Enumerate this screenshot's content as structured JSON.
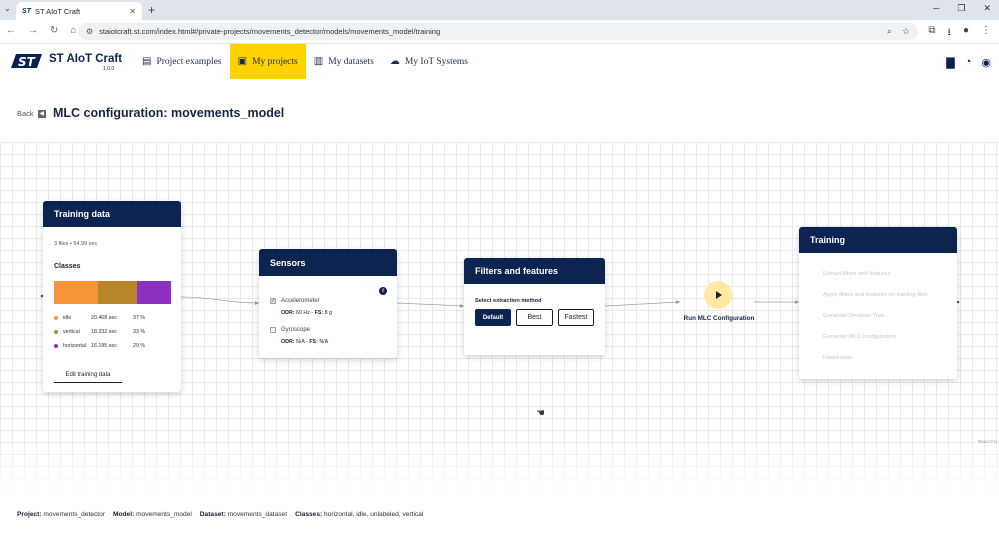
{
  "browser": {
    "tab_title": "ST AIoT Craft",
    "tab_favicon": "ST",
    "url": "staiotcraft.st.com/index.html#/private-projects/movements_detector/models/movements_model/training"
  },
  "app": {
    "brand": "ST AIoT Craft",
    "version": "1.0.0",
    "nav": [
      {
        "label": "Project examples",
        "icon": "folder-list-icon"
      },
      {
        "label": "My projects",
        "icon": "user-folder-icon",
        "active": true
      },
      {
        "label": "My datasets",
        "icon": "dataset-icon"
      },
      {
        "label": "My IoT Systems",
        "icon": "cloud-icon"
      }
    ],
    "accent_color": "#ffd200",
    "header_color": "#0d2350"
  },
  "page": {
    "back_label": "Back",
    "title": "MLC configuration: movements_model"
  },
  "training_data": {
    "title": "Training data",
    "meta": "3 files • 54.99 sec",
    "classes_label": "Classes",
    "classes": [
      {
        "name": "idle",
        "seconds": "20.468 sec",
        "percent": "37 %",
        "share": 37,
        "color": "#f7943a"
      },
      {
        "name": "vertical",
        "seconds": "18.332 sec",
        "percent": "33 %",
        "share": 33,
        "color": "#b8862a"
      },
      {
        "name": "horizontal",
        "seconds": "16.195 sec",
        "percent": "29 %",
        "share": 29,
        "color": "#8e2fc4"
      }
    ],
    "edit_label": "Edit training data"
  },
  "sensors": {
    "title": "Sensors",
    "items": [
      {
        "name": "Accelerometer",
        "checked": true,
        "odr_label": "ODR:",
        "odr": "60 Hz",
        "fs_label": "FS:",
        "fs": "8 g"
      },
      {
        "name": "Gyroscope",
        "checked": false,
        "odr_label": "ODR:",
        "odr": "N/A",
        "fs_label": "FS:",
        "fs": "N/A"
      }
    ]
  },
  "filters": {
    "title": "Filters and features",
    "label": "Select extraction method",
    "options": [
      "Default",
      "Best",
      "Fastest"
    ],
    "selected": "Default"
  },
  "run": {
    "label": "Run MLC Configuration"
  },
  "training": {
    "title": "Training",
    "steps": [
      "Extract filters and features",
      "Apply filters and features on training files",
      "Generate Decision Tree",
      "Generate MLC configuration",
      "Finalization"
    ]
  },
  "canvas": {
    "attribution": "React Flo"
  },
  "footer": {
    "project_label": "Project:",
    "project": "movements_detector",
    "model_label": "Model:",
    "model": "movements_model",
    "dataset_label": "Dataset:",
    "dataset": "movements_dataset",
    "classes_label": "Classes:",
    "classes": "horizontal, idle, unlabeled, vertical"
  }
}
